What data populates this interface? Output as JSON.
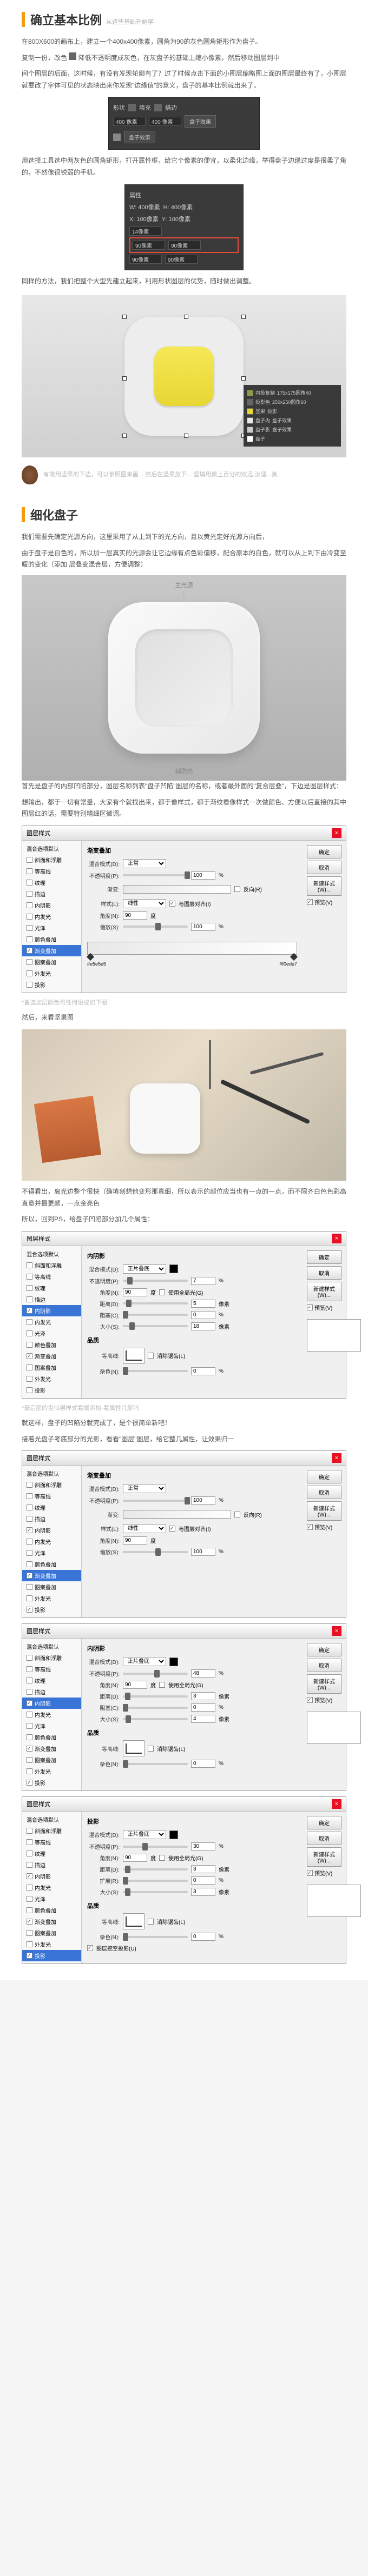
{
  "section1": {
    "title": "确立基本比例",
    "subtitle": "从这些基础开始学",
    "p1": "在800X600的画布上，建立一个400x400像素，圆角为90的灰色圆角矩形作为盘子。",
    "p2a": "复制一份，改色",
    "p2b": "降低不透明度成灰色，在灰盘子的基础上缩小像素，然后移动图层到中",
    "p3": "间个图层的后面，这时候，有没有发现轮廓有了？过了时候点击下面的小图层缩略图上面的图层最终有了，小图层就要改了字体可见的状态映出来你发现\"边缘值\"的意义，盘子的基本比例就出来了。",
    "panel1": {
      "fields": [
        "形状",
        "填充",
        "描边"
      ],
      "w": "400 像素",
      "h": "400 像素",
      "values": [
        "盒子效果",
        "盒子效果"
      ]
    },
    "p4": "用选择工具选中两灰色的圆角矩形，打开属性框，给它个像素的便宜，以柔化边缘，举得盘子边缘过度是很柔了角的，不然像很锐弱的手机。",
    "panel2": {
      "title": "属性",
      "w": "W: 400像素",
      "h": "H: 400像素",
      "x": "X: 100像素",
      "y": "Y: 100像素",
      "r": "14像素",
      "corners": [
        "90像素",
        "90像素",
        "90像素",
        "90像素"
      ]
    },
    "p5": "同样的方法，我们把整个大型先建立起来，利用形状图层的优势，随时做出调整。",
    "labelpanel": {
      "items": [
        {
          "color": "#8b9b4a",
          "name": "内投复制",
          "dim": "175x175圆角40"
        },
        {
          "color": "#666",
          "name": "投影色",
          "dim": "250x250圆角60"
        },
        {
          "color": "#e8d633",
          "name": "坚果",
          "dim": "投影"
        },
        {
          "color": "#e8e8e8",
          "name": "盘子内",
          "dim": "盒子效果"
        },
        {
          "color": "#ccc",
          "name": "盘子影",
          "dim": "盒子效果"
        },
        {
          "color": "#fff",
          "name": "盘子",
          "dim": ""
        }
      ]
    },
    "note": "有常用坚果的下边，可以参照图来画... 然后在坚果放下... 坚填用颜上百分的效迅,汝适...美..."
  },
  "section2": {
    "title": "细化盘子",
    "p1": "我们需要先确定光源方向，这里采用了从上到下的光方向，且以黄光定好光源方向后，",
    "p2": "由于盘子是白色的，所以加一层真实的光源会让它边缘有点色彩偏移，配合原本的白色，就可以从上到下由冷变至暖的变化（添加 层叠变混合层，方便调整）",
    "lights": {
      "top": "主光源",
      "bottom": "辅助光"
    },
    "p3": "首先是盘子的内部凹陷部分，图层名称列表\"盘子凹陷\"图层的名称，或者最外面的\"复合层叠\"，下边是图层样式：",
    "p4": "想输出，都于一切有常量，大家有个就找出来，都于像样式，都于渐纹看像样式一次做颜色、方便以后直接的其中图层红的话，需要特别精细区微调。",
    "dialog1": {
      "title": "图层样式",
      "styles": [
        "混合选项默认",
        "斜面和浮雕",
        "等高线",
        "纹理",
        "描边",
        "内阴影",
        "内发光",
        "光泽",
        "颜色叠加",
        "渐变叠加",
        "图案叠加",
        "外发光",
        "投影"
      ],
      "active": "渐变叠加",
      "section_title": "渐变叠加",
      "blend_label": "混合模式(D):",
      "blend_val": "正常",
      "opacity_label": "不透明度(P):",
      "opacity_val": "100",
      "gradient_label": "渐变:",
      "reverse": "反向(R)",
      "style_label": "样式(L):",
      "style_val": "线性",
      "align": "与图层对齐(I)",
      "angle_label": "角度(N):",
      "angle_val": "90",
      "scale_label": "缩放(S):",
      "scale_val": "100",
      "stops": [
        "#e5e5e5",
        "#f0ede7"
      ],
      "buttons": [
        "确定",
        "取消",
        "新建样式(W)...",
        "预览(V)"
      ]
    },
    "grey1": "*备选加层颜色可任何设成如下图",
    "photo_label": "然后，来看坚果图",
    "p5": "不得看出，离光边整个很快（确填刻想他变形那真细，所以表示的部位应当也有一点的一点，而不限齐白色色彩高直意并最更颜，一点金亮色",
    "p6": "所以，回到PS，给盘子凹陷部分加几个属性：",
    "dialog2": {
      "active": "内阴影",
      "section_title": "内阴影",
      "blend_val": "正片叠底",
      "opacity_val": "7",
      "angle_val": "90",
      "global": "使用全局光(G)",
      "distance_label": "距离(D):",
      "distance_val": "5",
      "choke_label": "阻塞(C):",
      "choke_val": "0",
      "size_label": "大小(S):",
      "size_val": "18",
      "quality": "品质",
      "contour_label": "等高线:",
      "anti": "消除锯齿(L)",
      "noise_label": "杂色(N):",
      "noise_val": "0"
    },
    "grey2": "*最后面的盘似层样式看属添加-看属性几解吗",
    "p7": "就这样，盘子的凹陷分就完成了，是个很简单新吧！",
    "p8": "接着光盘子考底部分的光影，看看\"图层\"图层，给它整几属性，让效果归一",
    "dialog3": {
      "active": "渐变叠加",
      "opacity_val": "100",
      "angle_val": "90",
      "scale_val": "100"
    },
    "dialog4": {
      "active": "内阴影",
      "blend_val": "正片叠底",
      "opacity_val": "48",
      "angle_val": "90",
      "distance_val": "3",
      "choke_val": "0",
      "size_val": "4"
    },
    "dialog5": {
      "active": "投影",
      "section_title": "投影",
      "blend_val": "正片叠底",
      "opacity_val": "30",
      "angle_val": "90",
      "distance_val": "3",
      "spread_label": "扩展(R):",
      "spread_val": "0",
      "size_val": "3",
      "knockout": "图层挖空投影(U)"
    }
  }
}
